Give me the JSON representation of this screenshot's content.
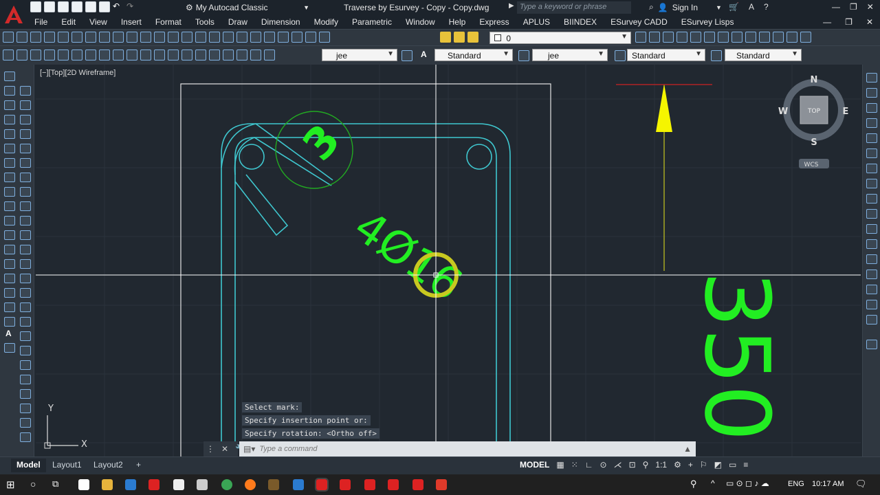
{
  "title_bar": {
    "workspace": "My Autocad Classic",
    "document_title": "Traverse by Esurvey - Copy - Copy.dwg",
    "search_placeholder": "Type a keyword or phrase",
    "sign_in": "Sign In"
  },
  "menu": [
    "File",
    "Edit",
    "View",
    "Insert",
    "Format",
    "Tools",
    "Draw",
    "Dimension",
    "Modify",
    "Parametric",
    "Window",
    "Help",
    "Express",
    "APLUS",
    "BIINDEX",
    "ESurvey CADD",
    "ESurvey Lisps"
  ],
  "layer": {
    "current": "0"
  },
  "style_toolbar": {
    "dimstyle_1": "jee",
    "text_style": "Standard",
    "dimstyle_2": "jee",
    "table_style": "Standard",
    "multileader_style": "Standard"
  },
  "viewport": {
    "label": "[−][Top][2D Wireframe]"
  },
  "viewcube": {
    "north": "N",
    "south": "S",
    "east": "E",
    "west": "W",
    "face": "TOP",
    "ucs": "WCS"
  },
  "ucs_icon": {
    "x": "X",
    "y": "Y"
  },
  "drawing_text": {
    "label_a": "3",
    "label_b": "4Ø16",
    "dimension": "350"
  },
  "command": {
    "history": [
      "Select mark:",
      "Specify insertion point or:",
      "Specify rotation:  <Ortho off>"
    ],
    "placeholder": "Type a command"
  },
  "layout_tabs": [
    "Model",
    "Layout1",
    "Layout2"
  ],
  "status": {
    "model": "MODEL",
    "scale": "1:1"
  },
  "taskbar": {
    "language": "ENG",
    "time": "10:17 AM"
  },
  "colors": {
    "cyan": "#3fc7cf",
    "green": "#22ee22",
    "yellow": "#c8c820",
    "crosshair": "#ffffff"
  }
}
